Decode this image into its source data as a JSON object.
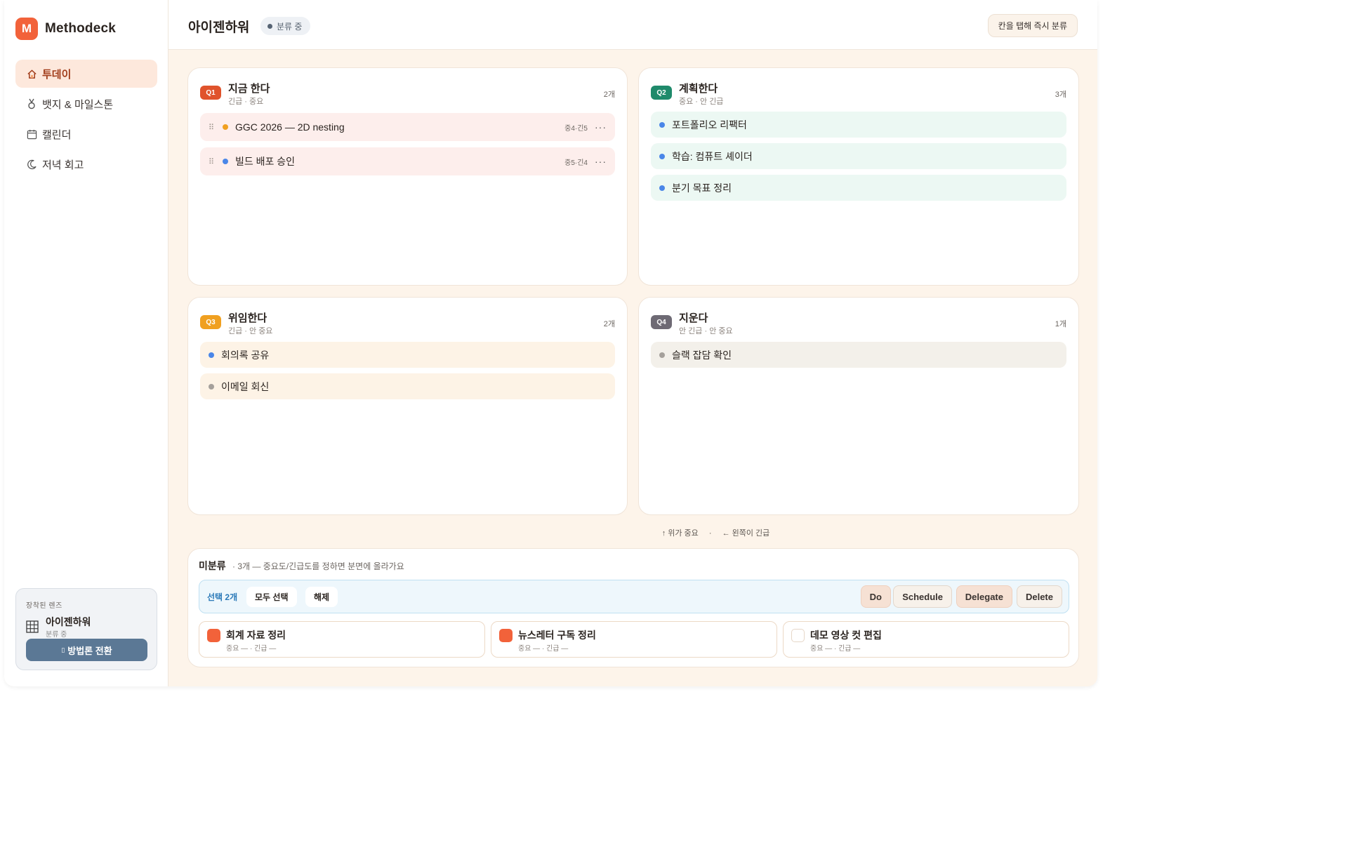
{
  "brand": {
    "mark": "M",
    "name": "Methodeck",
    "accent": "#f2623a"
  },
  "sidebar": {
    "items": [
      {
        "icon": "home-icon",
        "glyph": "⌂",
        "label": "투데이",
        "active": true
      },
      {
        "icon": "medal-icon",
        "glyph": "🏅",
        "label": "뱃지 & 마일스톤",
        "active": false
      },
      {
        "icon": "calendar-icon",
        "glyph": "▦",
        "label": "캘린더",
        "active": false
      },
      {
        "icon": "moon-icon",
        "glyph": "☽",
        "label": "저녁 회고",
        "active": false
      }
    ],
    "lens": {
      "caption": "장착된 렌즈",
      "icon": "grid-icon",
      "name": "아이젠하워",
      "status": "분류 중",
      "button": "방법론 전환",
      "button_icon": "swap-icon"
    }
  },
  "header": {
    "title": "아이젠하워",
    "status": "분류 중",
    "action": "칸을 탭해 즉시 분류"
  },
  "quadrants": [
    {
      "id": "q1",
      "badge": "Q1",
      "badge_color": "#e0532c",
      "title": "지금 한다",
      "subtitle": "긴급 · 중요",
      "count": "2개",
      "task_bg": "#fdeeec",
      "tasks": [
        {
          "label": "GGC 2026 — 2D nesting",
          "dot": "#f0a020",
          "meta": "중4·긴5",
          "has_handle": true
        },
        {
          "label": "빌드 배포 승인",
          "dot": "#4a86e8",
          "meta": "중5·긴4",
          "has_handle": true
        }
      ]
    },
    {
      "id": "q2",
      "badge": "Q2",
      "badge_color": "#1f8a6b",
      "title": "계획한다",
      "subtitle": "중요 · 안 긴급",
      "count": "3개",
      "task_bg": "#ecf8f3",
      "tasks": [
        {
          "label": "포트폴리오 리팩터",
          "dot": "#4a86e8"
        },
        {
          "label": "학습: 컴퓨트 셰이더",
          "dot": "#4a86e8"
        },
        {
          "label": "분기 목표 정리",
          "dot": "#4a86e8"
        }
      ]
    },
    {
      "id": "q3",
      "badge": "Q3",
      "badge_color": "#f0a020",
      "title": "위임한다",
      "subtitle": "긴급 · 안 중요",
      "count": "2개",
      "task_bg": "#fdf3e6",
      "tasks": [
        {
          "label": "회의록 공유",
          "dot": "#4a86e8"
        },
        {
          "label": "이메일 회신",
          "dot": "#a5a09b"
        }
      ]
    },
    {
      "id": "q4",
      "badge": "Q4",
      "badge_color": "#6e6a74",
      "title": "지운다",
      "subtitle": "안 긴급 · 안 중요",
      "count": "1개",
      "task_bg": "#f3f0ea",
      "tasks": [
        {
          "label": "슬랙 잡담 확인",
          "dot": "#a5a09b"
        }
      ]
    }
  ],
  "axis_hint": {
    "up": "↑ 위가 중요",
    "sep": "·",
    "left": "← 왼쪽이 긴급"
  },
  "unsorted": {
    "title": "미분류",
    "desc": "· 3개 — 중요도/긴급도를 정하면 분면에 올라가요",
    "selected": "선택 2개",
    "select_all": "모두 선택",
    "clear": "해제",
    "actions": [
      "Do",
      "Schedule",
      "Delegate",
      "Delete"
    ],
    "cards": [
      {
        "title": "회계 자료 정리",
        "meta": "중요 — · 긴급 —",
        "checked": true
      },
      {
        "title": "뉴스레터 구독 정리",
        "meta": "중요 — · 긴급 —",
        "checked": true
      },
      {
        "title": "데모 영상 컷 편집",
        "meta": "중요 — · 긴급 —",
        "checked": false
      }
    ]
  }
}
